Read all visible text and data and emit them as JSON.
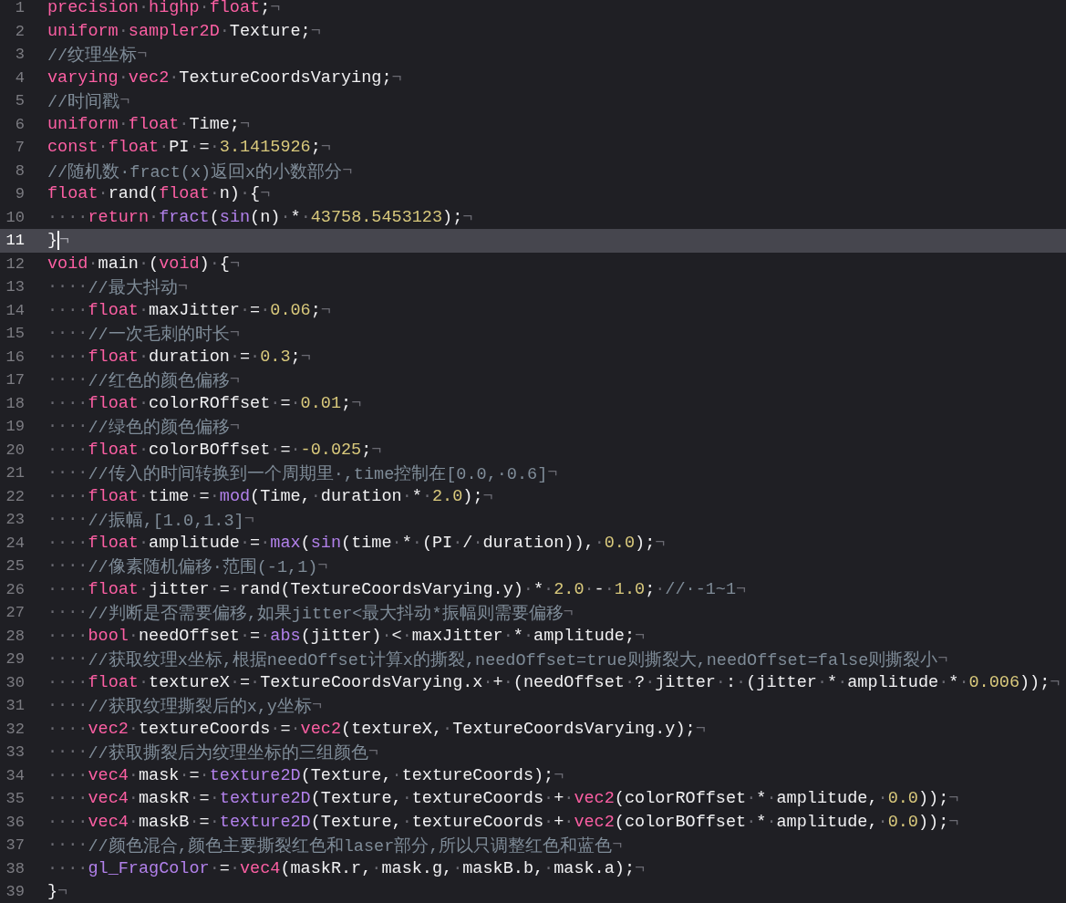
{
  "editor": {
    "lines": [
      {
        "number": "1",
        "selected": false,
        "tokens": [
          {
            "kind": "k",
            "text": "precision"
          },
          {
            "kind": "w",
            "text": "·"
          },
          {
            "kind": "k",
            "text": "highp"
          },
          {
            "kind": "w",
            "text": "·"
          },
          {
            "kind": "k",
            "text": "float"
          },
          {
            "kind": "t",
            "text": ";"
          },
          {
            "kind": "w",
            "text": "¬"
          }
        ]
      },
      {
        "number": "2",
        "selected": false,
        "tokens": [
          {
            "kind": "k",
            "text": "uniform"
          },
          {
            "kind": "w",
            "text": "·"
          },
          {
            "kind": "k",
            "text": "sampler2D"
          },
          {
            "kind": "w",
            "text": "·"
          },
          {
            "kind": "t",
            "text": "Texture;"
          },
          {
            "kind": "w",
            "text": "¬"
          }
        ]
      },
      {
        "number": "3",
        "selected": false,
        "tokens": [
          {
            "kind": "c",
            "text": "//纹理坐标"
          },
          {
            "kind": "w",
            "text": "¬"
          }
        ]
      },
      {
        "number": "4",
        "selected": false,
        "tokens": [
          {
            "kind": "k",
            "text": "varying"
          },
          {
            "kind": "w",
            "text": "·"
          },
          {
            "kind": "k",
            "text": "vec2"
          },
          {
            "kind": "w",
            "text": "·"
          },
          {
            "kind": "t",
            "text": "TextureCoordsVarying;"
          },
          {
            "kind": "w",
            "text": "¬"
          }
        ]
      },
      {
        "number": "5",
        "selected": false,
        "tokens": [
          {
            "kind": "c",
            "text": "//时间戳"
          },
          {
            "kind": "w",
            "text": "¬"
          }
        ]
      },
      {
        "number": "6",
        "selected": false,
        "tokens": [
          {
            "kind": "k",
            "text": "uniform"
          },
          {
            "kind": "w",
            "text": "·"
          },
          {
            "kind": "k",
            "text": "float"
          },
          {
            "kind": "w",
            "text": "·"
          },
          {
            "kind": "t",
            "text": "Time;"
          },
          {
            "kind": "w",
            "text": "¬"
          }
        ]
      },
      {
        "number": "7",
        "selected": false,
        "tokens": [
          {
            "kind": "k",
            "text": "const"
          },
          {
            "kind": "w",
            "text": "·"
          },
          {
            "kind": "k",
            "text": "float"
          },
          {
            "kind": "w",
            "text": "·"
          },
          {
            "kind": "t",
            "text": "PI"
          },
          {
            "kind": "w",
            "text": "·"
          },
          {
            "kind": "t",
            "text": "="
          },
          {
            "kind": "w",
            "text": "·"
          },
          {
            "kind": "n",
            "text": "3.1415926"
          },
          {
            "kind": "t",
            "text": ";"
          },
          {
            "kind": "w",
            "text": "¬"
          }
        ]
      },
      {
        "number": "8",
        "selected": false,
        "tokens": [
          {
            "kind": "c",
            "text": "//随机数·fract(x)返回x的小数部分"
          },
          {
            "kind": "w",
            "text": "¬"
          }
        ]
      },
      {
        "number": "9",
        "selected": false,
        "tokens": [
          {
            "kind": "k",
            "text": "float"
          },
          {
            "kind": "w",
            "text": "·"
          },
          {
            "kind": "t",
            "text": "rand("
          },
          {
            "kind": "k",
            "text": "float"
          },
          {
            "kind": "w",
            "text": "·"
          },
          {
            "kind": "t",
            "text": "n)"
          },
          {
            "kind": "w",
            "text": "·"
          },
          {
            "kind": "t",
            "text": "{"
          },
          {
            "kind": "w",
            "text": "¬"
          }
        ]
      },
      {
        "number": "10",
        "selected": false,
        "tokens": [
          {
            "kind": "w",
            "text": "····"
          },
          {
            "kind": "k",
            "text": "return"
          },
          {
            "kind": "w",
            "text": "·"
          },
          {
            "kind": "f",
            "text": "fract"
          },
          {
            "kind": "t",
            "text": "("
          },
          {
            "kind": "f",
            "text": "sin"
          },
          {
            "kind": "t",
            "text": "(n)"
          },
          {
            "kind": "w",
            "text": "·"
          },
          {
            "kind": "t",
            "text": "*"
          },
          {
            "kind": "w",
            "text": "·"
          },
          {
            "kind": "n",
            "text": "43758.5453123"
          },
          {
            "kind": "t",
            "text": ");"
          },
          {
            "kind": "w",
            "text": "¬"
          }
        ]
      },
      {
        "number": "11",
        "selected": true,
        "tokens": [
          {
            "kind": "t",
            "text": "}"
          },
          {
            "kind": "w",
            "text": "¬"
          }
        ]
      },
      {
        "number": "12",
        "selected": false,
        "tokens": [
          {
            "kind": "k",
            "text": "void"
          },
          {
            "kind": "w",
            "text": "·"
          },
          {
            "kind": "t",
            "text": "main"
          },
          {
            "kind": "w",
            "text": "·"
          },
          {
            "kind": "t",
            "text": "("
          },
          {
            "kind": "k",
            "text": "void"
          },
          {
            "kind": "t",
            "text": ")"
          },
          {
            "kind": "w",
            "text": "·"
          },
          {
            "kind": "t",
            "text": "{"
          },
          {
            "kind": "w",
            "text": "¬"
          }
        ]
      },
      {
        "number": "13",
        "selected": false,
        "tokens": [
          {
            "kind": "w",
            "text": "····"
          },
          {
            "kind": "c",
            "text": "//最大抖动"
          },
          {
            "kind": "w",
            "text": "¬"
          }
        ]
      },
      {
        "number": "14",
        "selected": false,
        "tokens": [
          {
            "kind": "w",
            "text": "····"
          },
          {
            "kind": "k",
            "text": "float"
          },
          {
            "kind": "w",
            "text": "·"
          },
          {
            "kind": "t",
            "text": "maxJitter"
          },
          {
            "kind": "w",
            "text": "·"
          },
          {
            "kind": "t",
            "text": "="
          },
          {
            "kind": "w",
            "text": "·"
          },
          {
            "kind": "n",
            "text": "0.06"
          },
          {
            "kind": "t",
            "text": ";"
          },
          {
            "kind": "w",
            "text": "¬"
          }
        ]
      },
      {
        "number": "15",
        "selected": false,
        "tokens": [
          {
            "kind": "w",
            "text": "····"
          },
          {
            "kind": "c",
            "text": "//一次毛刺的时长"
          },
          {
            "kind": "w",
            "text": "¬"
          }
        ]
      },
      {
        "number": "16",
        "selected": false,
        "tokens": [
          {
            "kind": "w",
            "text": "····"
          },
          {
            "kind": "k",
            "text": "float"
          },
          {
            "kind": "w",
            "text": "·"
          },
          {
            "kind": "t",
            "text": "duration"
          },
          {
            "kind": "w",
            "text": "·"
          },
          {
            "kind": "t",
            "text": "="
          },
          {
            "kind": "w",
            "text": "·"
          },
          {
            "kind": "n",
            "text": "0.3"
          },
          {
            "kind": "t",
            "text": ";"
          },
          {
            "kind": "w",
            "text": "¬"
          }
        ]
      },
      {
        "number": "17",
        "selected": false,
        "tokens": [
          {
            "kind": "w",
            "text": "····"
          },
          {
            "kind": "c",
            "text": "//红色的颜色偏移"
          },
          {
            "kind": "w",
            "text": "¬"
          }
        ]
      },
      {
        "number": "18",
        "selected": false,
        "tokens": [
          {
            "kind": "w",
            "text": "····"
          },
          {
            "kind": "k",
            "text": "float"
          },
          {
            "kind": "w",
            "text": "·"
          },
          {
            "kind": "t",
            "text": "colorROffset"
          },
          {
            "kind": "w",
            "text": "·"
          },
          {
            "kind": "t",
            "text": "="
          },
          {
            "kind": "w",
            "text": "·"
          },
          {
            "kind": "n",
            "text": "0.01"
          },
          {
            "kind": "t",
            "text": ";"
          },
          {
            "kind": "w",
            "text": "¬"
          }
        ]
      },
      {
        "number": "19",
        "selected": false,
        "tokens": [
          {
            "kind": "w",
            "text": "····"
          },
          {
            "kind": "c",
            "text": "//绿色的颜色偏移"
          },
          {
            "kind": "w",
            "text": "¬"
          }
        ]
      },
      {
        "number": "20",
        "selected": false,
        "tokens": [
          {
            "kind": "w",
            "text": "····"
          },
          {
            "kind": "k",
            "text": "float"
          },
          {
            "kind": "w",
            "text": "·"
          },
          {
            "kind": "t",
            "text": "colorBOffset"
          },
          {
            "kind": "w",
            "text": "·"
          },
          {
            "kind": "t",
            "text": "="
          },
          {
            "kind": "w",
            "text": "·"
          },
          {
            "kind": "n",
            "text": "-0.025"
          },
          {
            "kind": "t",
            "text": ";"
          },
          {
            "kind": "w",
            "text": "¬"
          }
        ]
      },
      {
        "number": "21",
        "selected": false,
        "tokens": [
          {
            "kind": "w",
            "text": "····"
          },
          {
            "kind": "c",
            "text": "//传入的时间转换到一个周期里·,time控制在[0.0,·0.6]"
          },
          {
            "kind": "w",
            "text": "¬"
          }
        ]
      },
      {
        "number": "22",
        "selected": false,
        "tokens": [
          {
            "kind": "w",
            "text": "····"
          },
          {
            "kind": "k",
            "text": "float"
          },
          {
            "kind": "w",
            "text": "·"
          },
          {
            "kind": "t",
            "text": "time"
          },
          {
            "kind": "w",
            "text": "·"
          },
          {
            "kind": "t",
            "text": "="
          },
          {
            "kind": "w",
            "text": "·"
          },
          {
            "kind": "f",
            "text": "mod"
          },
          {
            "kind": "t",
            "text": "(Time,"
          },
          {
            "kind": "w",
            "text": "·"
          },
          {
            "kind": "t",
            "text": "duration"
          },
          {
            "kind": "w",
            "text": "·"
          },
          {
            "kind": "t",
            "text": "*"
          },
          {
            "kind": "w",
            "text": "·"
          },
          {
            "kind": "n",
            "text": "2.0"
          },
          {
            "kind": "t",
            "text": ");"
          },
          {
            "kind": "w",
            "text": "¬"
          }
        ]
      },
      {
        "number": "23",
        "selected": false,
        "tokens": [
          {
            "kind": "w",
            "text": "····"
          },
          {
            "kind": "c",
            "text": "//振幅,[1.0,1.3]"
          },
          {
            "kind": "w",
            "text": "¬"
          }
        ]
      },
      {
        "number": "24",
        "selected": false,
        "tokens": [
          {
            "kind": "w",
            "text": "····"
          },
          {
            "kind": "k",
            "text": "float"
          },
          {
            "kind": "w",
            "text": "·"
          },
          {
            "kind": "t",
            "text": "amplitude"
          },
          {
            "kind": "w",
            "text": "·"
          },
          {
            "kind": "t",
            "text": "="
          },
          {
            "kind": "w",
            "text": "·"
          },
          {
            "kind": "f",
            "text": "max"
          },
          {
            "kind": "t",
            "text": "("
          },
          {
            "kind": "f",
            "text": "sin"
          },
          {
            "kind": "t",
            "text": "(time"
          },
          {
            "kind": "w",
            "text": "·"
          },
          {
            "kind": "t",
            "text": "*"
          },
          {
            "kind": "w",
            "text": "·"
          },
          {
            "kind": "t",
            "text": "(PI"
          },
          {
            "kind": "w",
            "text": "·"
          },
          {
            "kind": "t",
            "text": "/"
          },
          {
            "kind": "w",
            "text": "·"
          },
          {
            "kind": "t",
            "text": "duration)),"
          },
          {
            "kind": "w",
            "text": "·"
          },
          {
            "kind": "n",
            "text": "0.0"
          },
          {
            "kind": "t",
            "text": ");"
          },
          {
            "kind": "w",
            "text": "¬"
          }
        ]
      },
      {
        "number": "25",
        "selected": false,
        "tokens": [
          {
            "kind": "w",
            "text": "····"
          },
          {
            "kind": "c",
            "text": "//像素随机偏移·范围(-1,1)"
          },
          {
            "kind": "w",
            "text": "¬"
          }
        ]
      },
      {
        "number": "26",
        "selected": false,
        "tokens": [
          {
            "kind": "w",
            "text": "····"
          },
          {
            "kind": "k",
            "text": "float"
          },
          {
            "kind": "w",
            "text": "·"
          },
          {
            "kind": "t",
            "text": "jitter"
          },
          {
            "kind": "w",
            "text": "·"
          },
          {
            "kind": "t",
            "text": "="
          },
          {
            "kind": "w",
            "text": "·"
          },
          {
            "kind": "t",
            "text": "rand(TextureCoordsVarying.y)"
          },
          {
            "kind": "w",
            "text": "·"
          },
          {
            "kind": "t",
            "text": "*"
          },
          {
            "kind": "w",
            "text": "·"
          },
          {
            "kind": "n",
            "text": "2.0"
          },
          {
            "kind": "w",
            "text": "·"
          },
          {
            "kind": "t",
            "text": "-"
          },
          {
            "kind": "w",
            "text": "·"
          },
          {
            "kind": "n",
            "text": "1.0"
          },
          {
            "kind": "t",
            "text": ";"
          },
          {
            "kind": "w",
            "text": "·"
          },
          {
            "kind": "c",
            "text": "//·-1~1"
          },
          {
            "kind": "w",
            "text": "¬"
          }
        ]
      },
      {
        "number": "27",
        "selected": false,
        "tokens": [
          {
            "kind": "w",
            "text": "····"
          },
          {
            "kind": "c",
            "text": "//判断是否需要偏移,如果jitter<最大抖动*振幅则需要偏移"
          },
          {
            "kind": "w",
            "text": "¬"
          }
        ]
      },
      {
        "number": "28",
        "selected": false,
        "tokens": [
          {
            "kind": "w",
            "text": "····"
          },
          {
            "kind": "k",
            "text": "bool"
          },
          {
            "kind": "w",
            "text": "·"
          },
          {
            "kind": "t",
            "text": "needOffset"
          },
          {
            "kind": "w",
            "text": "·"
          },
          {
            "kind": "t",
            "text": "="
          },
          {
            "kind": "w",
            "text": "·"
          },
          {
            "kind": "f",
            "text": "abs"
          },
          {
            "kind": "t",
            "text": "(jitter)"
          },
          {
            "kind": "w",
            "text": "·"
          },
          {
            "kind": "t",
            "text": "<"
          },
          {
            "kind": "w",
            "text": "·"
          },
          {
            "kind": "t",
            "text": "maxJitter"
          },
          {
            "kind": "w",
            "text": "·"
          },
          {
            "kind": "t",
            "text": "*"
          },
          {
            "kind": "w",
            "text": "·"
          },
          {
            "kind": "t",
            "text": "amplitude;"
          },
          {
            "kind": "w",
            "text": "¬"
          }
        ]
      },
      {
        "number": "29",
        "selected": false,
        "tokens": [
          {
            "kind": "w",
            "text": "····"
          },
          {
            "kind": "c",
            "text": "//获取纹理x坐标,根据needOffset计算x的撕裂,needOffset=true则撕裂大,needOffset=false则撕裂小"
          },
          {
            "kind": "w",
            "text": "¬"
          }
        ]
      },
      {
        "number": "30",
        "selected": false,
        "tokens": [
          {
            "kind": "w",
            "text": "····"
          },
          {
            "kind": "k",
            "text": "float"
          },
          {
            "kind": "w",
            "text": "·"
          },
          {
            "kind": "t",
            "text": "textureX"
          },
          {
            "kind": "w",
            "text": "·"
          },
          {
            "kind": "t",
            "text": "="
          },
          {
            "kind": "w",
            "text": "·"
          },
          {
            "kind": "t",
            "text": "TextureCoordsVarying.x"
          },
          {
            "kind": "w",
            "text": "·"
          },
          {
            "kind": "t",
            "text": "+"
          },
          {
            "kind": "w",
            "text": "·"
          },
          {
            "kind": "t",
            "text": "(needOffset"
          },
          {
            "kind": "w",
            "text": "·"
          },
          {
            "kind": "t",
            "text": "?"
          },
          {
            "kind": "w",
            "text": "·"
          },
          {
            "kind": "t",
            "text": "jitter"
          },
          {
            "kind": "w",
            "text": "·"
          },
          {
            "kind": "t",
            "text": ":"
          },
          {
            "kind": "w",
            "text": "·"
          },
          {
            "kind": "t",
            "text": "(jitter"
          },
          {
            "kind": "w",
            "text": "·"
          },
          {
            "kind": "t",
            "text": "*"
          },
          {
            "kind": "w",
            "text": "·"
          },
          {
            "kind": "t",
            "text": "amplitude"
          },
          {
            "kind": "w",
            "text": "·"
          },
          {
            "kind": "t",
            "text": "*"
          },
          {
            "kind": "w",
            "text": "·"
          },
          {
            "kind": "n",
            "text": "0.006"
          },
          {
            "kind": "t",
            "text": "));"
          },
          {
            "kind": "w",
            "text": "¬"
          }
        ]
      },
      {
        "number": "31",
        "selected": false,
        "tokens": [
          {
            "kind": "w",
            "text": "····"
          },
          {
            "kind": "c",
            "text": "//获取纹理撕裂后的x,y坐标"
          },
          {
            "kind": "w",
            "text": "¬"
          }
        ]
      },
      {
        "number": "32",
        "selected": false,
        "tokens": [
          {
            "kind": "w",
            "text": "····"
          },
          {
            "kind": "k",
            "text": "vec2"
          },
          {
            "kind": "w",
            "text": "·"
          },
          {
            "kind": "t",
            "text": "textureCoords"
          },
          {
            "kind": "w",
            "text": "·"
          },
          {
            "kind": "t",
            "text": "="
          },
          {
            "kind": "w",
            "text": "·"
          },
          {
            "kind": "k",
            "text": "vec2"
          },
          {
            "kind": "t",
            "text": "(textureX,"
          },
          {
            "kind": "w",
            "text": "·"
          },
          {
            "kind": "t",
            "text": "TextureCoordsVarying.y);"
          },
          {
            "kind": "w",
            "text": "¬"
          }
        ]
      },
      {
        "number": "33",
        "selected": false,
        "tokens": [
          {
            "kind": "w",
            "text": "····"
          },
          {
            "kind": "c",
            "text": "//获取撕裂后为纹理坐标的三组颜色"
          },
          {
            "kind": "w",
            "text": "¬"
          }
        ]
      },
      {
        "number": "34",
        "selected": false,
        "tokens": [
          {
            "kind": "w",
            "text": "····"
          },
          {
            "kind": "k",
            "text": "vec4"
          },
          {
            "kind": "w",
            "text": "·"
          },
          {
            "kind": "t",
            "text": "mask"
          },
          {
            "kind": "w",
            "text": "·"
          },
          {
            "kind": "t",
            "text": "="
          },
          {
            "kind": "w",
            "text": "·"
          },
          {
            "kind": "f",
            "text": "texture2D"
          },
          {
            "kind": "t",
            "text": "(Texture,"
          },
          {
            "kind": "w",
            "text": "·"
          },
          {
            "kind": "t",
            "text": "textureCoords);"
          },
          {
            "kind": "w",
            "text": "¬"
          }
        ]
      },
      {
        "number": "35",
        "selected": false,
        "tokens": [
          {
            "kind": "w",
            "text": "····"
          },
          {
            "kind": "k",
            "text": "vec4"
          },
          {
            "kind": "w",
            "text": "·"
          },
          {
            "kind": "t",
            "text": "maskR"
          },
          {
            "kind": "w",
            "text": "·"
          },
          {
            "kind": "t",
            "text": "="
          },
          {
            "kind": "w",
            "text": "·"
          },
          {
            "kind": "f",
            "text": "texture2D"
          },
          {
            "kind": "t",
            "text": "(Texture,"
          },
          {
            "kind": "w",
            "text": "·"
          },
          {
            "kind": "t",
            "text": "textureCoords"
          },
          {
            "kind": "w",
            "text": "·"
          },
          {
            "kind": "t",
            "text": "+"
          },
          {
            "kind": "w",
            "text": "·"
          },
          {
            "kind": "k",
            "text": "vec2"
          },
          {
            "kind": "t",
            "text": "(colorROffset"
          },
          {
            "kind": "w",
            "text": "·"
          },
          {
            "kind": "t",
            "text": "*"
          },
          {
            "kind": "w",
            "text": "·"
          },
          {
            "kind": "t",
            "text": "amplitude,"
          },
          {
            "kind": "w",
            "text": "·"
          },
          {
            "kind": "n",
            "text": "0.0"
          },
          {
            "kind": "t",
            "text": "));"
          },
          {
            "kind": "w",
            "text": "¬"
          }
        ]
      },
      {
        "number": "36",
        "selected": false,
        "tokens": [
          {
            "kind": "w",
            "text": "····"
          },
          {
            "kind": "k",
            "text": "vec4"
          },
          {
            "kind": "w",
            "text": "·"
          },
          {
            "kind": "t",
            "text": "maskB"
          },
          {
            "kind": "w",
            "text": "·"
          },
          {
            "kind": "t",
            "text": "="
          },
          {
            "kind": "w",
            "text": "·"
          },
          {
            "kind": "f",
            "text": "texture2D"
          },
          {
            "kind": "t",
            "text": "(Texture,"
          },
          {
            "kind": "w",
            "text": "·"
          },
          {
            "kind": "t",
            "text": "textureCoords"
          },
          {
            "kind": "w",
            "text": "·"
          },
          {
            "kind": "t",
            "text": "+"
          },
          {
            "kind": "w",
            "text": "·"
          },
          {
            "kind": "k",
            "text": "vec2"
          },
          {
            "kind": "t",
            "text": "(colorBOffset"
          },
          {
            "kind": "w",
            "text": "·"
          },
          {
            "kind": "t",
            "text": "*"
          },
          {
            "kind": "w",
            "text": "·"
          },
          {
            "kind": "t",
            "text": "amplitude,"
          },
          {
            "kind": "w",
            "text": "·"
          },
          {
            "kind": "n",
            "text": "0.0"
          },
          {
            "kind": "t",
            "text": "));"
          },
          {
            "kind": "w",
            "text": "¬"
          }
        ]
      },
      {
        "number": "37",
        "selected": false,
        "tokens": [
          {
            "kind": "w",
            "text": "····"
          },
          {
            "kind": "c",
            "text": "//颜色混合,颜色主要撕裂红色和laser部分,所以只调整红色和蓝色"
          },
          {
            "kind": "w",
            "text": "¬"
          }
        ]
      },
      {
        "number": "38",
        "selected": false,
        "tokens": [
          {
            "kind": "w",
            "text": "····"
          },
          {
            "kind": "f",
            "text": "gl_FragColor"
          },
          {
            "kind": "w",
            "text": "·"
          },
          {
            "kind": "t",
            "text": "="
          },
          {
            "kind": "w",
            "text": "·"
          },
          {
            "kind": "k",
            "text": "vec4"
          },
          {
            "kind": "t",
            "text": "(maskR.r,"
          },
          {
            "kind": "w",
            "text": "·"
          },
          {
            "kind": "t",
            "text": "mask.g,"
          },
          {
            "kind": "w",
            "text": "·"
          },
          {
            "kind": "t",
            "text": "maskB.b,"
          },
          {
            "kind": "w",
            "text": "·"
          },
          {
            "kind": "t",
            "text": "mask.a);"
          },
          {
            "kind": "w",
            "text": "¬"
          }
        ]
      },
      {
        "number": "39",
        "selected": false,
        "tokens": [
          {
            "kind": "t",
            "text": "}"
          },
          {
            "kind": "w",
            "text": "¬"
          }
        ]
      }
    ]
  }
}
